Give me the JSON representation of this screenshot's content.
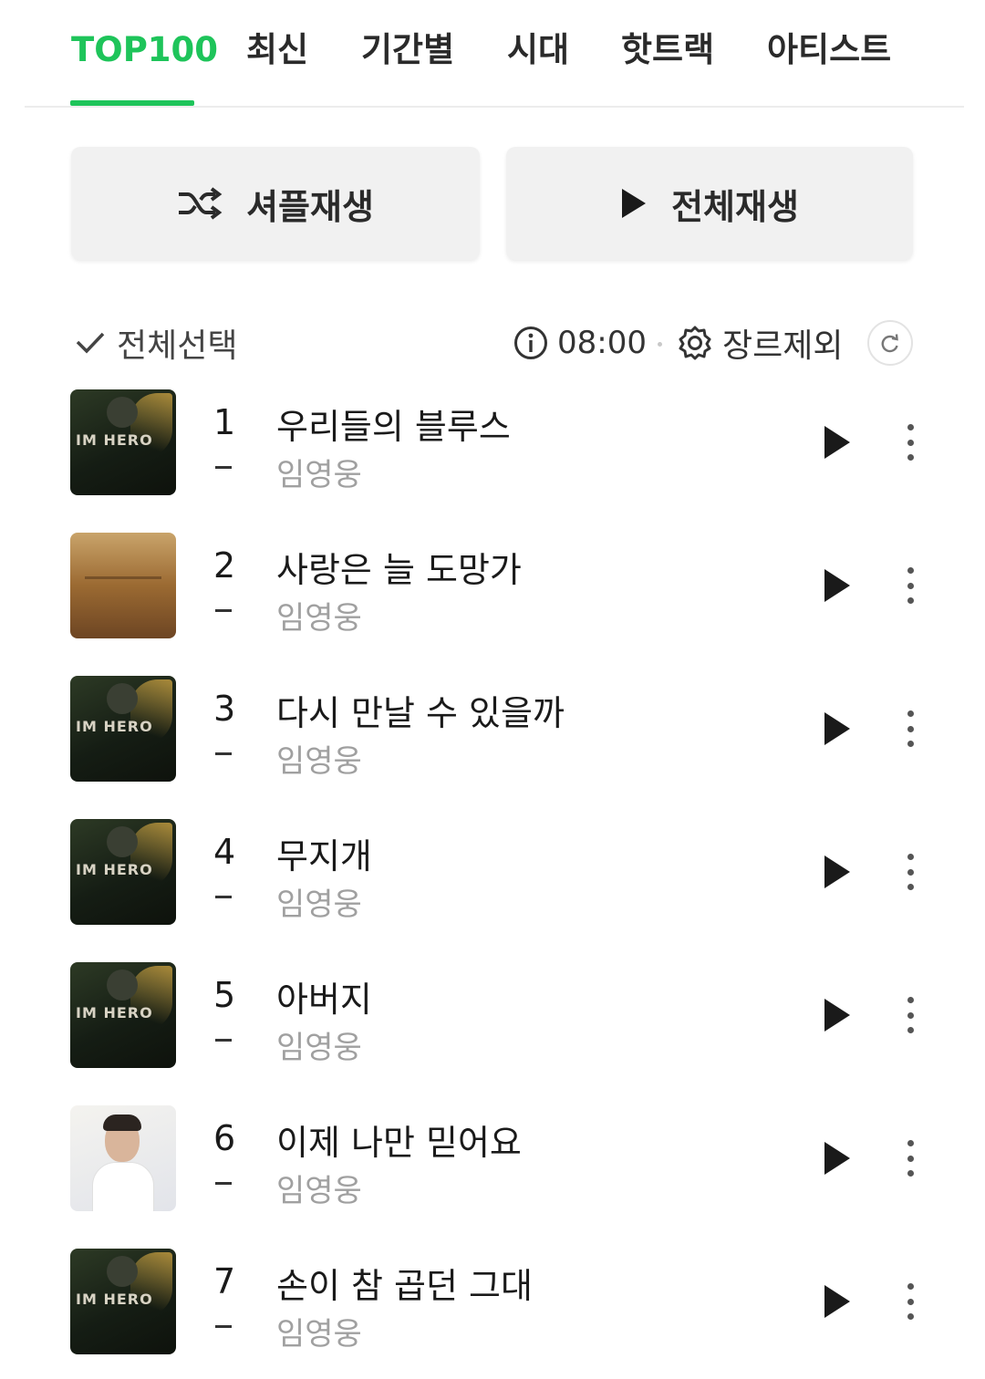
{
  "tabs": [
    {
      "label": "TOP100",
      "active": true
    },
    {
      "label": "최신",
      "active": false
    },
    {
      "label": "기간별",
      "active": false
    },
    {
      "label": "시대",
      "active": false
    },
    {
      "label": "핫트랙",
      "active": false
    },
    {
      "label": "아티스트",
      "active": false
    }
  ],
  "accent_color": "#1ec45a",
  "actions": {
    "shuffle_label": "셔플재생",
    "shuffle_icon": "shuffle-icon",
    "play_all_label": "전체재생",
    "play_all_icon": "play-icon"
  },
  "controls": {
    "select_all_label": "전체선택",
    "timer_value": "08:00",
    "genre_exclude_label": "장르제외"
  },
  "songs": [
    {
      "rank": "1",
      "title": "우리들의 블루스",
      "artist": "임영웅",
      "cover": "hero"
    },
    {
      "rank": "2",
      "title": "사랑은 늘 도망가",
      "artist": "임영웅",
      "cover": "desert"
    },
    {
      "rank": "3",
      "title": "다시 만날 수 있을까",
      "artist": "임영웅",
      "cover": "hero"
    },
    {
      "rank": "4",
      "title": "무지개",
      "artist": "임영웅",
      "cover": "hero"
    },
    {
      "rank": "5",
      "title": "아버지",
      "artist": "임영웅",
      "cover": "hero"
    },
    {
      "rank": "6",
      "title": "이제 나만 믿어요",
      "artist": "임영웅",
      "cover": "portrait"
    },
    {
      "rank": "7",
      "title": "손이 참 곱던 그대",
      "artist": "임영웅",
      "cover": "hero"
    }
  ],
  "cover_text": "IM HERO"
}
